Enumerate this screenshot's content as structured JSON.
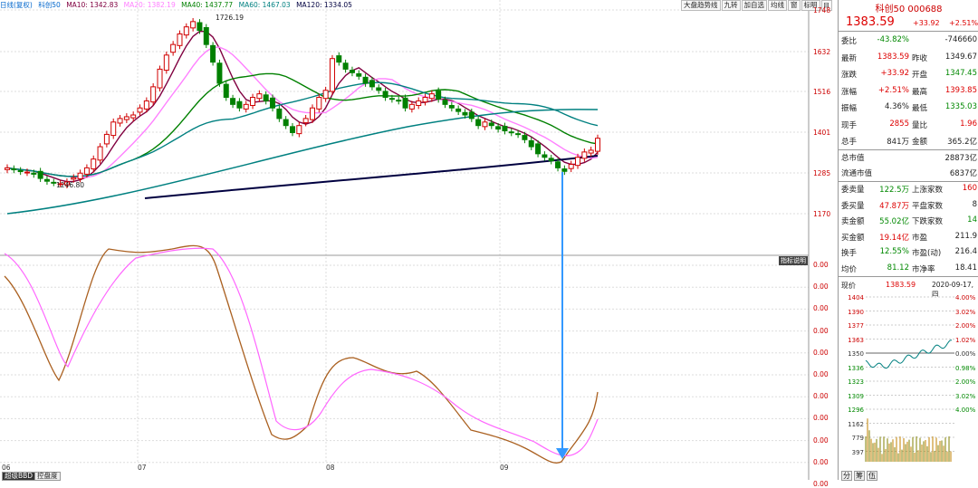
{
  "header": {
    "period": "日线(复权)",
    "symbol": "科创50",
    "ma10": "MA10: 1342.83",
    "ma20": "MA20: 1382.19",
    "ma40": "MA40: 1437.77",
    "ma60": "MA60: 1467.03",
    "ma120": "MA120: 1334.05"
  },
  "toolbar": [
    "大盘趋势线",
    "九转",
    "加自选",
    "均线",
    "窗",
    "标明",
    "⊟"
  ],
  "price_axis": [
    "1748",
    "1632",
    "1516",
    "1401",
    "1285",
    "1170"
  ],
  "indicator_axis": [
    "0.00",
    "0.00",
    "0.00",
    "0.00",
    "0.00",
    "0.00",
    "0.00",
    "0.00",
    "0.00",
    "0.00",
    "0.00"
  ],
  "annotations": {
    "high": "1726.19",
    "low": "1246.80",
    "indicator_label": "指标说明"
  },
  "x_labels": [
    "06",
    "07",
    "08",
    "09"
  ],
  "bottom_tabs": [
    "超级BBD",
    "控盘度"
  ],
  "colors": {
    "up": "#d00000",
    "down": "#008000",
    "ma10": "#800040",
    "ma20": "#ff80ff",
    "ma40": "#008000",
    "ma60": "#008080",
    "ma120": "#000040",
    "arrow": "#3399ff"
  },
  "quote": {
    "name_code": "科创50 000688",
    "price": "1383.59",
    "change": "+33.92",
    "change_pct": "+2.51%"
  },
  "stats": [
    {
      "k": "委比",
      "v": "-43.82%",
      "vc": "grn",
      "k2": "",
      "v2": "-746660",
      "v2c": ""
    },
    {
      "k": "最新",
      "v": "1383.59",
      "vc": "red",
      "k2": "昨收",
      "v2": "1349.67",
      "v2c": ""
    },
    {
      "k": "涨跌",
      "v": "+33.92",
      "vc": "red",
      "k2": "开盘",
      "v2": "1347.45",
      "v2c": "grn"
    },
    {
      "k": "涨幅",
      "v": "+2.51%",
      "vc": "red",
      "k2": "最高",
      "v2": "1393.85",
      "v2c": "red"
    },
    {
      "k": "振幅",
      "v": "4.36%",
      "vc": "",
      "k2": "最低",
      "v2": "1335.03",
      "v2c": "grn"
    },
    {
      "k": "现手",
      "v": "2855",
      "vc": "red",
      "k2": "量比",
      "v2": "1.96",
      "v2c": "red"
    },
    {
      "k": "总手",
      "v": "841万",
      "vc": "",
      "k2": "金额",
      "v2": "365.2亿",
      "v2c": ""
    }
  ],
  "cap": [
    {
      "k": "总市值",
      "v": "28873亿"
    },
    {
      "k": "流通市值",
      "v": "6837亿"
    }
  ],
  "breadth": [
    {
      "k": "委卖量",
      "v": "122.5万",
      "vc": "grn",
      "k2": "上涨家数",
      "v2": "160",
      "v2c": "red"
    },
    {
      "k": "委买量",
      "v": "47.87万",
      "vc": "red",
      "k2": "平盘家数",
      "v2": "8",
      "v2c": ""
    },
    {
      "k": "卖金额",
      "v": "55.02亿",
      "vc": "grn",
      "k2": "下跌家数",
      "v2": "14",
      "v2c": "grn"
    },
    {
      "k": "买金额",
      "v": "19.14亿",
      "vc": "red",
      "k2": "市盈",
      "v2": "211.9",
      "v2c": ""
    },
    {
      "k": "换手",
      "v": "12.55%",
      "vc": "grn",
      "k2": "市盈(动)",
      "v2": "216.4",
      "v2c": ""
    },
    {
      "k": "均价",
      "v": "81.12",
      "vc": "grn",
      "k2": "市净率",
      "v2": "18.41",
      "v2c": ""
    }
  ],
  "now": {
    "label": "现价",
    "price": "1383.59",
    "date": "2020-09-17,四"
  },
  "mini_axis_left": [
    "1404",
    "1390",
    "1377",
    "1363",
    "1350",
    "1336",
    "1323",
    "1309",
    "1296",
    "1162",
    "779",
    "397"
  ],
  "mini_axis_right": [
    "4.00%",
    "3.02%",
    "2.00%",
    "1.02%",
    "0.00%",
    "0.98%",
    "2.00%",
    "3.02%",
    "4.00%"
  ],
  "panel_tabs": [
    "分",
    "筹",
    "伍"
  ]
}
